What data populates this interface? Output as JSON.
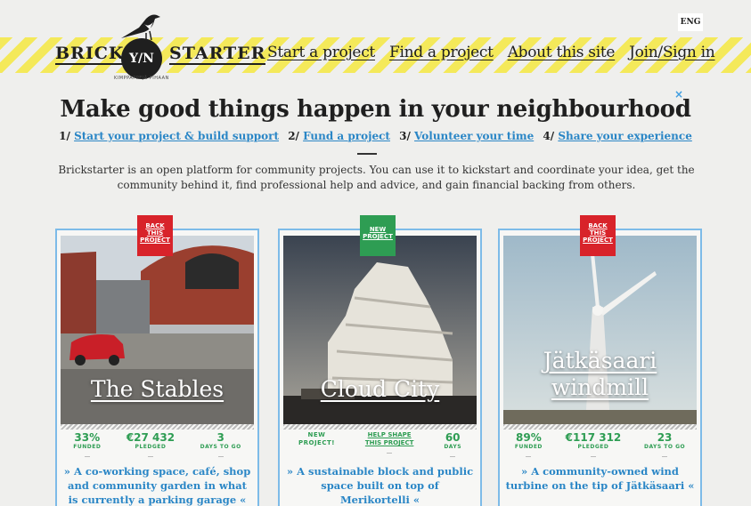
{
  "header": {
    "lang": "ENG",
    "logo": {
      "left_word": "BRICK",
      "right_word": "STARTER",
      "circle_text": "Y/N",
      "tagline": "KIMPPAPPEJÄ PIHAAN"
    },
    "nav": [
      "Start a project",
      "Find a project",
      "About this site",
      "Join/Sign in"
    ]
  },
  "hero": {
    "close": "×",
    "title": "Make good things happen in your neighbourhood",
    "steps": [
      {
        "num": "1/",
        "label": "Start your project & build support"
      },
      {
        "num": "2/",
        "label": "Fund a project"
      },
      {
        "num": "3/",
        "label": "Volunteer your time"
      },
      {
        "num": "4/",
        "label": "Share your experience"
      }
    ],
    "intro": "Brickstarter is an open platform for community projects. You can use it to kickstart and coordinate your idea, get the community behind it, find professional help and advice, and gain financial backing from others."
  },
  "cards": [
    {
      "badge": [
        "BACK",
        "THIS",
        "PROJECT"
      ],
      "title": "The Stables",
      "stats": [
        {
          "value": "33%",
          "label": "FUNDED"
        },
        {
          "value": "€27 432",
          "label": "PLEDGED"
        },
        {
          "value": "3",
          "label": "DAYS TO GO"
        }
      ],
      "desc": "» A co-working space, café, shop and community garden in what is currently a parking garage «"
    },
    {
      "badge": [
        "NEW",
        "PROJECT"
      ],
      "title": "Cloud City",
      "new_label": [
        "NEW",
        "PROJECT!"
      ],
      "help": [
        "HELP SHAPE",
        "THIS PROJECT"
      ],
      "days": {
        "value": "60",
        "label": "DAYS"
      },
      "desc": "» A sustainable block and public space built on top of Merikortelli «"
    },
    {
      "badge": [
        "BACK",
        "THIS",
        "PROJECT"
      ],
      "title_lines": [
        "Jätkäsaari",
        "windmill"
      ],
      "stats": [
        {
          "value": "89%",
          "label": "FUNDED"
        },
        {
          "value": "€117 312",
          "label": "PLEDGED"
        },
        {
          "value": "23",
          "label": "DAYS TO GO"
        }
      ],
      "desc": "» A community-owned wind turbine on the tip of Jätkäsaari «"
    }
  ]
}
